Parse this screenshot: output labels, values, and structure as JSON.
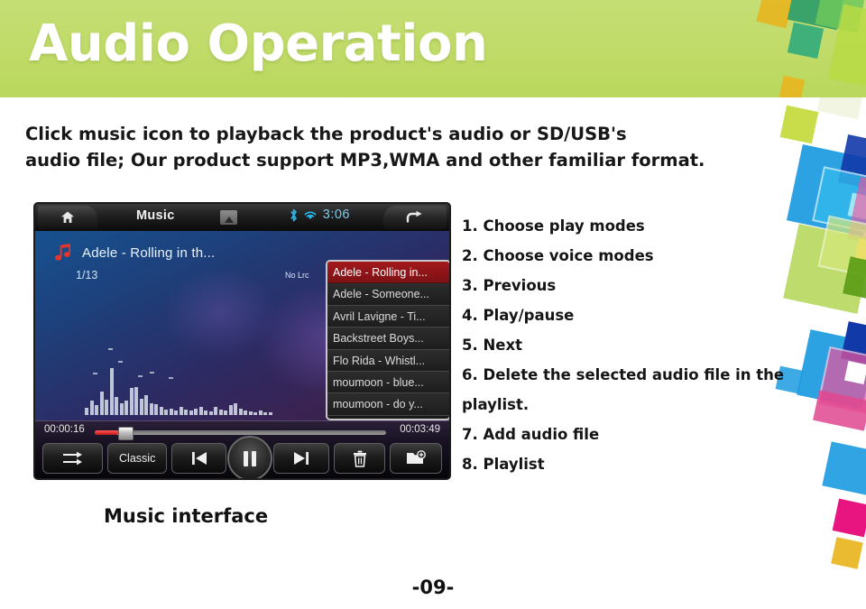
{
  "slide": {
    "title": "Audio Operation",
    "page_number": "-09-",
    "caption": "Music interface",
    "body_lines": [
      "Click music icon to playback the product's  audio or SD/USB's",
      "audio file; Our product support MP3,WMA and other familiar format."
    ]
  },
  "colors": {
    "header_green": "#c0db67",
    "accent_red": "#a3191c",
    "status_cyan": "#7fc9e8",
    "deco_blue": "#1b9ae0",
    "deco_pink": "#e8559f",
    "deco_green": "#a8cf3d",
    "deco_yellow": "#e8b51f"
  },
  "player": {
    "topbar": {
      "home_icon": "home-icon",
      "title": "Music",
      "album_art_icon": "picture-icon",
      "bluetooth_icon": "bluetooth-icon",
      "wifi_icon": "wifi-icon",
      "clock": "3:06",
      "return_icon": "return-arrow-icon"
    },
    "now_playing": {
      "music_note_icon": "music-note-icon",
      "track_title": "Adele - Rolling in th...",
      "track_index": "1/13",
      "lyrics_status": "No Lrc",
      "list_toggle_icon": "list-icon"
    },
    "playlist": {
      "items": [
        {
          "label": "Adele - Rolling in...",
          "selected": true
        },
        {
          "label": "Adele - Someone...",
          "selected": false
        },
        {
          "label": "Avril Lavigne - Ti...",
          "selected": false
        },
        {
          "label": "Backstreet Boys...",
          "selected": false
        },
        {
          "label": "Flo Rida - Whistl...",
          "selected": false
        },
        {
          "label": "moumoon - blue...",
          "selected": false
        },
        {
          "label": "moumoon - do y...",
          "selected": false
        }
      ]
    },
    "transport": {
      "current_time": "00:00:16",
      "total_time": "00:03:49",
      "progress_percent": 8,
      "play_mode_icon": "shuffle-icon",
      "voice_mode_label": "Classic",
      "previous_icon": "previous-icon",
      "play_pause_icon": "pause-icon",
      "next_icon": "next-icon",
      "delete_icon": "trash-icon",
      "add_file_icon": "add-file-icon"
    }
  },
  "callouts": [
    "1. Choose play modes",
    "2. Choose voice modes",
    "3. Previous",
    "4. Play/pause",
    "5. Next",
    "6. Delete the selected audio file in the",
    "playlist.",
    "7. Add audio file",
    "8. Playlist"
  ]
}
